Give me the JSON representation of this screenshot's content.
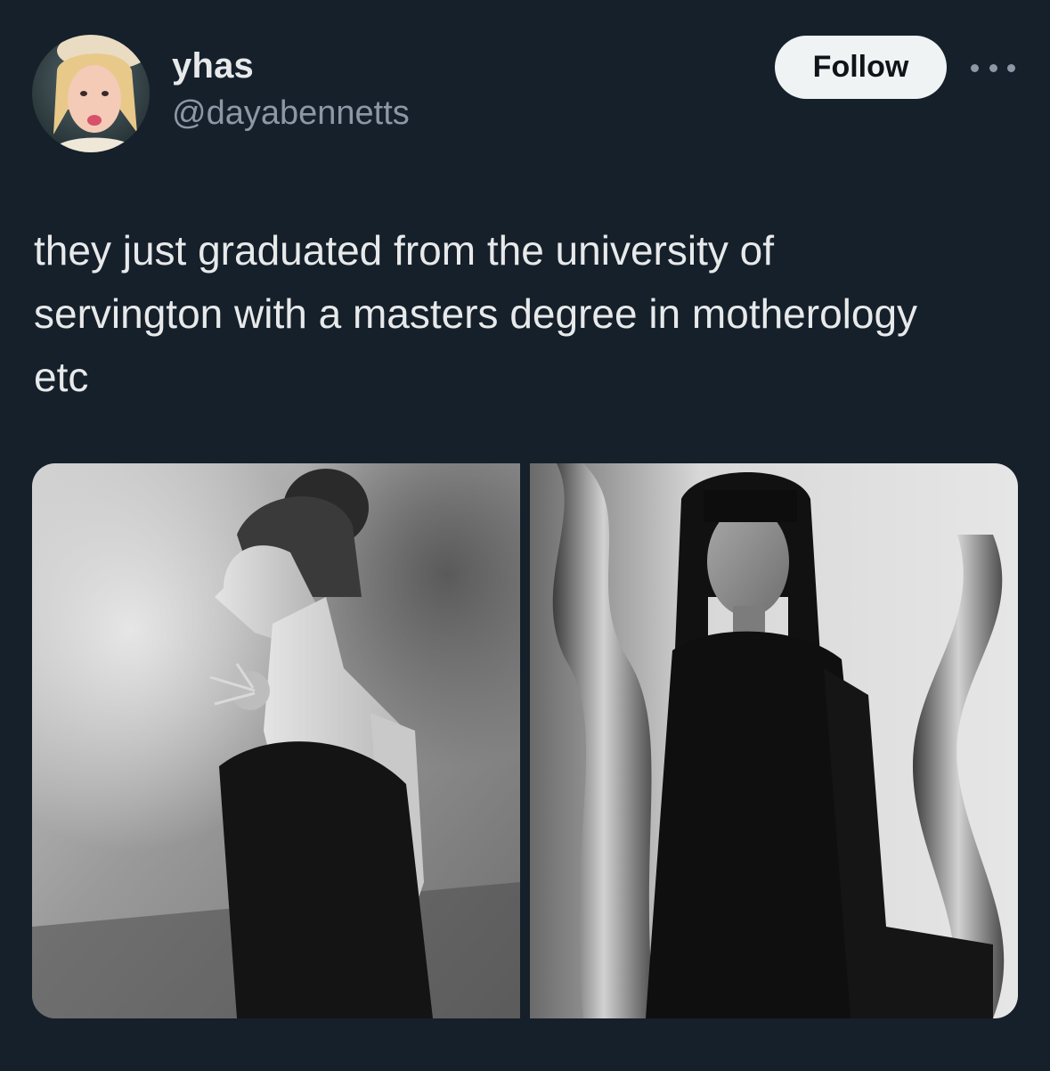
{
  "author": {
    "display_name": "yhas",
    "handle": "@dayabennetts"
  },
  "actions": {
    "follow_label": "Follow"
  },
  "tweet": {
    "text": "they just graduated from the university of\nservington with a masters degree in motherology\netc"
  },
  "media": {
    "photo_count": 2
  },
  "colors": {
    "background": "#16202a",
    "primary_text": "#e7e9ea",
    "secondary_text": "#8b98a5",
    "follow_button_bg": "#eff3f4",
    "follow_button_text": "#0f1419"
  },
  "icons": {
    "more": "more-horizontal-icon"
  }
}
